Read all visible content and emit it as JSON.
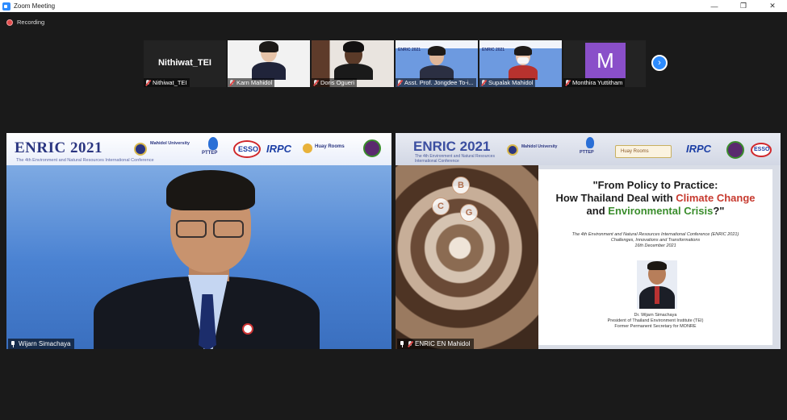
{
  "window": {
    "title": "Zoom Meeting",
    "minimize_glyph": "—",
    "restore_glyph": "❐",
    "close_glyph": "✕"
  },
  "recording": {
    "label": "Recording",
    "color": "#e14b4b"
  },
  "participants_strip": [
    {
      "name": "Nithiwat_TEI",
      "display": "Nithiwat_TEI",
      "video": false
    },
    {
      "name": "Karn Mahidol",
      "video": true
    },
    {
      "name": "Doris Ogueri",
      "video": true
    },
    {
      "name": "Asst. Prof. Jongdee To-i...",
      "video": true
    },
    {
      "name": "Supalak Mahidol",
      "video": true
    },
    {
      "name": "Monthira Yuttitham",
      "avatar_letter": "M",
      "avatar_color": "#8a4fc9",
      "video": false
    }
  ],
  "next_page_glyph": "›",
  "main_left": {
    "name": "Wijarn Simachaya",
    "banner_title": "ENRIC 2021",
    "banner_sub": "The 4th Environment and Natural Resources International Conference",
    "logos": [
      "Mahidol University",
      "PTTEP",
      "ESSO",
      "IRPC",
      "Huay Rooms"
    ]
  },
  "main_right": {
    "name": "ENRIC EN Mahidol",
    "banner_title": "ENRIC 2021",
    "banner_sub": "The 4th Environment and Natural Resources International Conference",
    "bcg_letters": [
      "B",
      "C",
      "G"
    ],
    "slide": {
      "line1": "\"From Policy to Practice:",
      "line2_prefix": "How Thailand Deal with ",
      "line2_red": "Climate Change",
      "line3_prefix": "and ",
      "line3_green": "Environmental Crisis",
      "line3_suffix": "?\"",
      "desc1": "The 4th Environment and Natural Resources International Conference (ENRIC 2021)",
      "desc2": "Challenges, Innovations and Transformations",
      "desc3": "16th December 2021",
      "speaker_name": "Dr. Wijarn Simachaya",
      "speaker_role1": "President of Thailand Environment Institute (TEI)",
      "speaker_role2": "Former Permanent Secretary for MONRE"
    }
  }
}
